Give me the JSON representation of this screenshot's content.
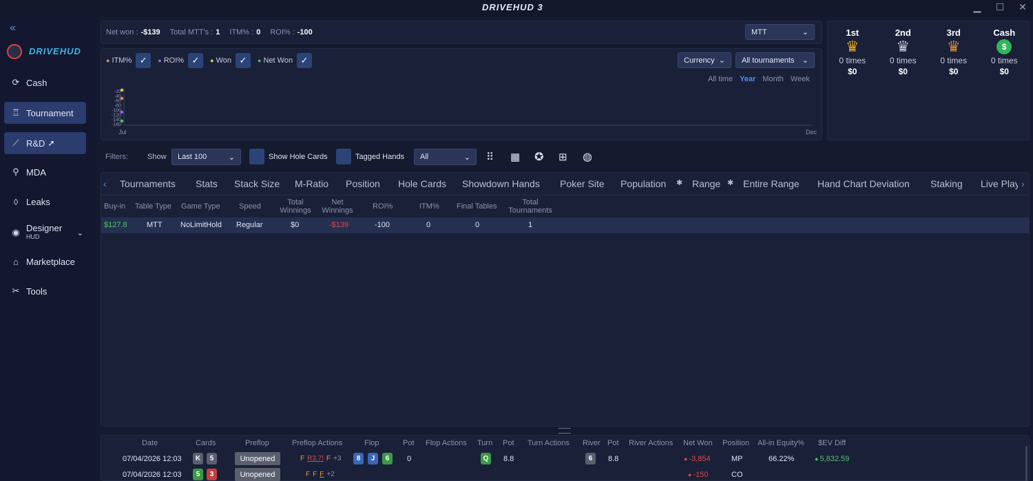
{
  "app": {
    "title": "DRIVEHUD 3"
  },
  "sidebar": {
    "logo_text": "DRIVEHUD",
    "items": [
      {
        "label": "Cash",
        "icon": "cash-icon"
      },
      {
        "label": "Tournament",
        "icon": "trophy-icon"
      },
      {
        "label": "R&D",
        "icon": "chart-line-icon"
      },
      {
        "label": "MDA",
        "icon": "mda-icon"
      },
      {
        "label": "Leaks",
        "icon": "drop-icon"
      },
      {
        "label": "Designer",
        "sublabel": "HUD",
        "icon": "eye-icon"
      },
      {
        "label": "Marketplace",
        "icon": "store-icon"
      },
      {
        "label": "Tools",
        "icon": "tools-icon"
      }
    ]
  },
  "summary": {
    "net_won_label": "Net won :",
    "net_won": "-$139",
    "total_mtts_label": "Total MTT's :",
    "total_mtts": "1",
    "itm_label": "ITM% :",
    "itm": "0",
    "roi_label": "ROI% :",
    "roi": "-100",
    "game_type": "MTT"
  },
  "chart_controls": {
    "series_toggles": [
      {
        "label": "ITM%",
        "color": "#e8894a"
      },
      {
        "label": "ROI%",
        "color": "#a066e0"
      },
      {
        "label": "Won",
        "color": "#e6d23c"
      },
      {
        "label": "Net Won",
        "color": "#46c46a"
      }
    ],
    "currency": "Currency",
    "tournaments": "All tournaments",
    "periods": [
      "All time",
      "Year",
      "Month",
      "Week"
    ],
    "active_period": "Year"
  },
  "chart_data": {
    "type": "line",
    "y_ticks": [
      "-20",
      "-40",
      "-60",
      "-80",
      "-100",
      "-120",
      "-140",
      "-160"
    ],
    "x_start": "Jul",
    "x_end": "Dec",
    "series": [
      {
        "name": "ITM%",
        "values": []
      },
      {
        "name": "ROI%",
        "values": []
      },
      {
        "name": "Won",
        "values": []
      },
      {
        "name": "Net Won",
        "values": []
      }
    ]
  },
  "placements": [
    {
      "label": "1st",
      "times": "0 times",
      "amount": "$0",
      "icon": "gold-trophy-icon"
    },
    {
      "label": "2nd",
      "times": "0 times",
      "amount": "$0",
      "icon": "silver-trophy-icon"
    },
    {
      "label": "3rd",
      "times": "0 times",
      "amount": "$0",
      "icon": "bronze-trophy-icon"
    },
    {
      "label": "Cash",
      "times": "0 times",
      "amount": "$0",
      "icon": "dollar-icon"
    }
  ],
  "filters": {
    "label": "Filters:",
    "show_label": "Show",
    "show_value": "Last 100",
    "show_hole_cards": "Show Hole Cards",
    "tagged_hands": "Tagged Hands",
    "tag_value": "All"
  },
  "tabs": [
    "Tournaments",
    "Stats",
    "Stack Size",
    "M-Ratio",
    "Position",
    "Hole Cards",
    "Showdown Hands",
    "Poker Site",
    "Population",
    "Range",
    "Entire Range",
    "Hand Chart Deviation",
    "Staking",
    "Live Play"
  ],
  "tournament_table": {
    "headers": [
      "Buy-in",
      "Table Type",
      "Game Type",
      "Speed",
      "Total Winnings",
      "Net Winnings",
      "ROI%",
      "ITM%",
      "Final Tables",
      "Total Tournaments"
    ],
    "rows": [
      [
        "$127.88",
        "MTT",
        "NoLimitHold",
        "Regular",
        "$0",
        "-$139",
        "-100",
        "0",
        "0",
        "1"
      ]
    ]
  },
  "hands_table": {
    "headers": [
      "Date",
      "Cards",
      "Preflop",
      "Preflop Actions",
      "Flop",
      "Pot",
      "Flop Actions",
      "Turn",
      "Pot",
      "Turn Actions",
      "River",
      "Pot",
      "River Actions",
      "Net Won",
      "Position",
      "All-in Equity%",
      "$EV Diff"
    ],
    "rows": [
      {
        "date": "07/04/2026 12:03",
        "cards": [
          "K",
          "5"
        ],
        "preflop": "Unopened",
        "preflop_actions": [
          "F",
          "R3.7!",
          "F",
          "+3"
        ],
        "flop": [
          "8",
          "J",
          "6"
        ],
        "flop_pot": "0",
        "turn": "Q",
        "turn_pot": "8.8",
        "river": "6",
        "river_pot": "8.8",
        "net_won": "-3,854",
        "position": "MP",
        "equity": "66.22%",
        "ev_diff": "5,832.59"
      },
      {
        "date": "07/04/2026 12:03",
        "cards": [
          "5",
          "3"
        ],
        "preflop": "Unopened",
        "preflop_actions": [
          "F",
          "F",
          "F",
          "+2"
        ],
        "flop": [],
        "flop_pot": "",
        "turn": "",
        "turn_pot": "",
        "river": "",
        "river_pot": "",
        "net_won": "-150",
        "position": "CO",
        "equity": "",
        "ev_diff": ""
      }
    ]
  }
}
